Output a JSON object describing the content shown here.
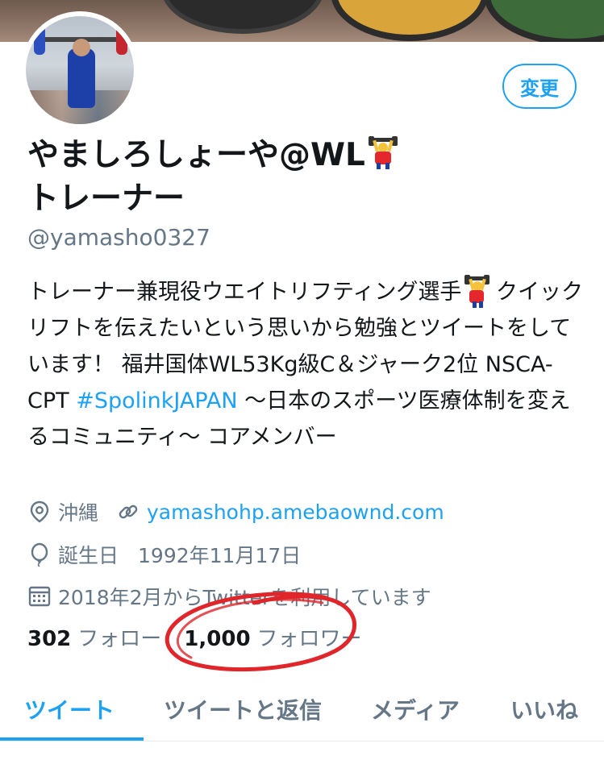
{
  "profile": {
    "edit_label": "変更",
    "name_line1": "やましろしょーや@WL",
    "name_line2": "トレーナー",
    "name_emoji": "weightlifter-emoji",
    "handle": "@yamasho0327"
  },
  "bio": {
    "part1": "トレーナー兼現役ウエイトリフティング選手",
    "part2": " クイックリフトを伝えたいという思いから勉強とツイートをしています！ 福井国体WL53Kg級C＆ジャーク2位 NSCA-CPT ",
    "hashtag": "#SpolinkJAPAN",
    "part3": " 〜日本のスポーツ医療体制を変えるコミュニティ〜 コアメンバー"
  },
  "meta": {
    "location": "沖縄",
    "website": "yamashohp.amebaownd.com",
    "birthday_label": "誕生日",
    "birthday_value": "1992年11月17日",
    "joined": "2018年2月からTwitterを利用しています"
  },
  "stats": {
    "following_count": "302",
    "following_label": "フォロー",
    "followers_count": "1,000",
    "followers_label": "フォロワー"
  },
  "tabs": [
    {
      "label": "ツイート",
      "active": true
    },
    {
      "label": "ツイートと返信",
      "active": false
    },
    {
      "label": "メディア",
      "active": false
    },
    {
      "label": "いいね",
      "active": false
    }
  ],
  "colors": {
    "accent": "#1da1f2",
    "secondary_text": "#657786",
    "primary_text": "#14171a",
    "annotation": "#e0262b"
  }
}
